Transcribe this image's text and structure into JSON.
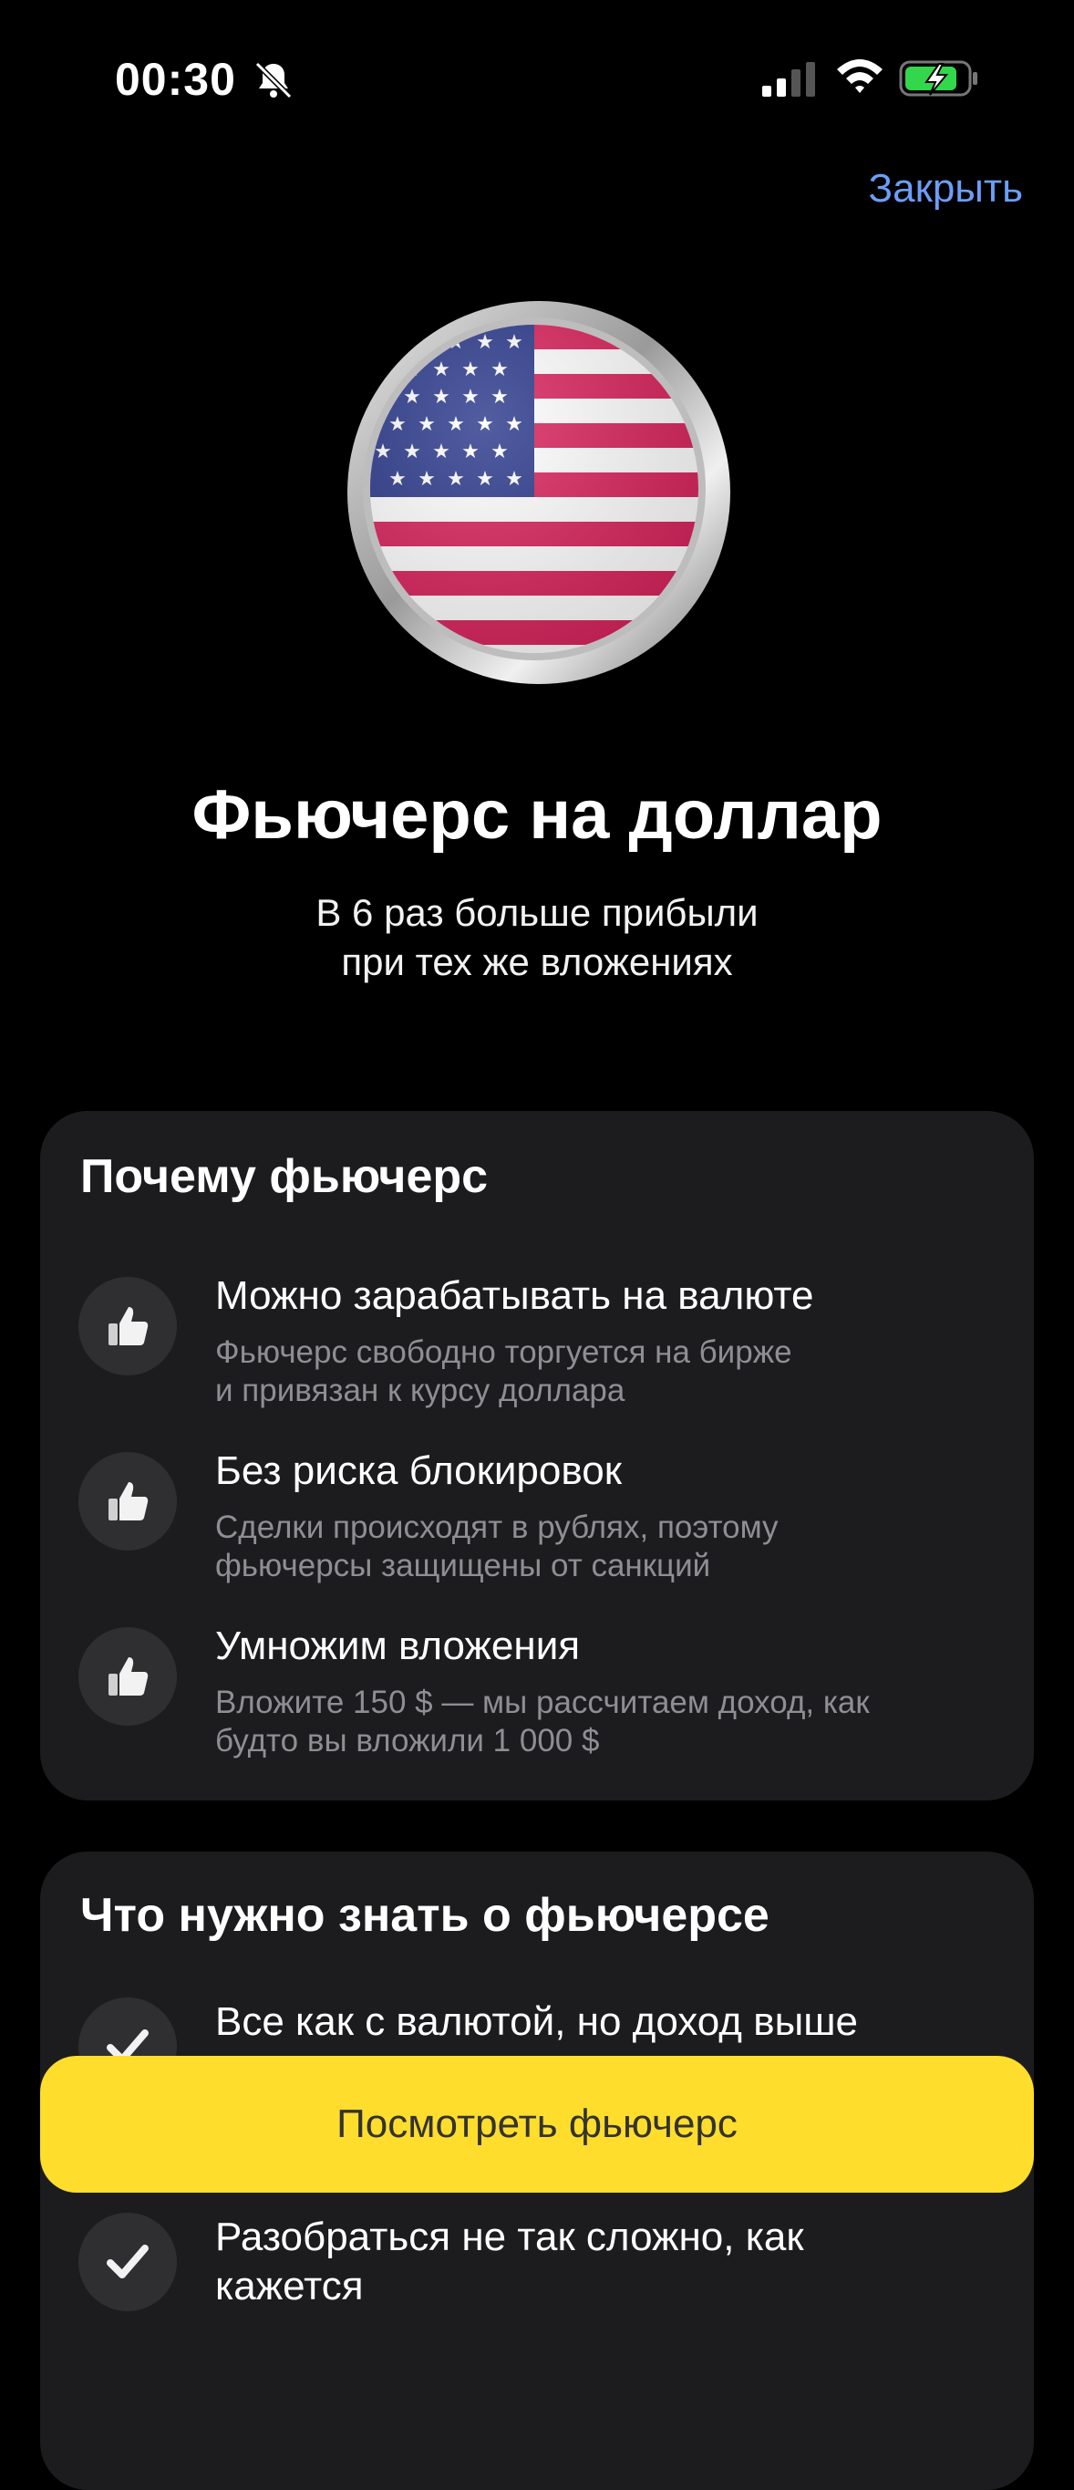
{
  "status_bar": {
    "time": "00:30",
    "icons": [
      "bell-slash-icon",
      "cellular-signal-icon",
      "wifi-icon",
      "battery-charging-icon"
    ],
    "battery_color": "#32d74b"
  },
  "header": {
    "close_label": "Закрыть",
    "close_color": "#6c9ef8"
  },
  "hero": {
    "image": "us-flag-coin",
    "title": "Фьючерс на доллар",
    "subtitle_line1": "В 6 раз больше прибыли",
    "subtitle_line2": "при тех же вложениях"
  },
  "why_card": {
    "title": "Почему фьючерс",
    "items": [
      {
        "icon": "thumbs-up-icon",
        "title": "Можно зарабатывать на валюте",
        "desc_line1": "Фьючерс свободно торгуется на бирже",
        "desc_line2": "и привязан к курсу доллара"
      },
      {
        "icon": "thumbs-up-icon",
        "title": "Без риска блокировок",
        "desc_line1": "Сделки происходят в рублях, поэтому",
        "desc_line2": "фьючерсы защищены от санкций"
      },
      {
        "icon": "thumbs-up-icon",
        "title": "Умножим вложения",
        "desc_line1": "Вложите 150 $ — мы рассчитаем доход, как",
        "desc_line2": "будто вы вложили 1 000 $"
      }
    ]
  },
  "know_card": {
    "title": "Что нужно знать о фьючерсе",
    "items": [
      {
        "icon": "checkmark-icon",
        "title": "Все как с валютой, но доход выше"
      },
      {
        "icon": "checkmark-icon",
        "title_line1": "Разобраться не так сложно, как",
        "title_line2": "кажется"
      }
    ]
  },
  "cta": {
    "label": "Посмотреть фьючерс",
    "color": "#ffdd2d"
  }
}
